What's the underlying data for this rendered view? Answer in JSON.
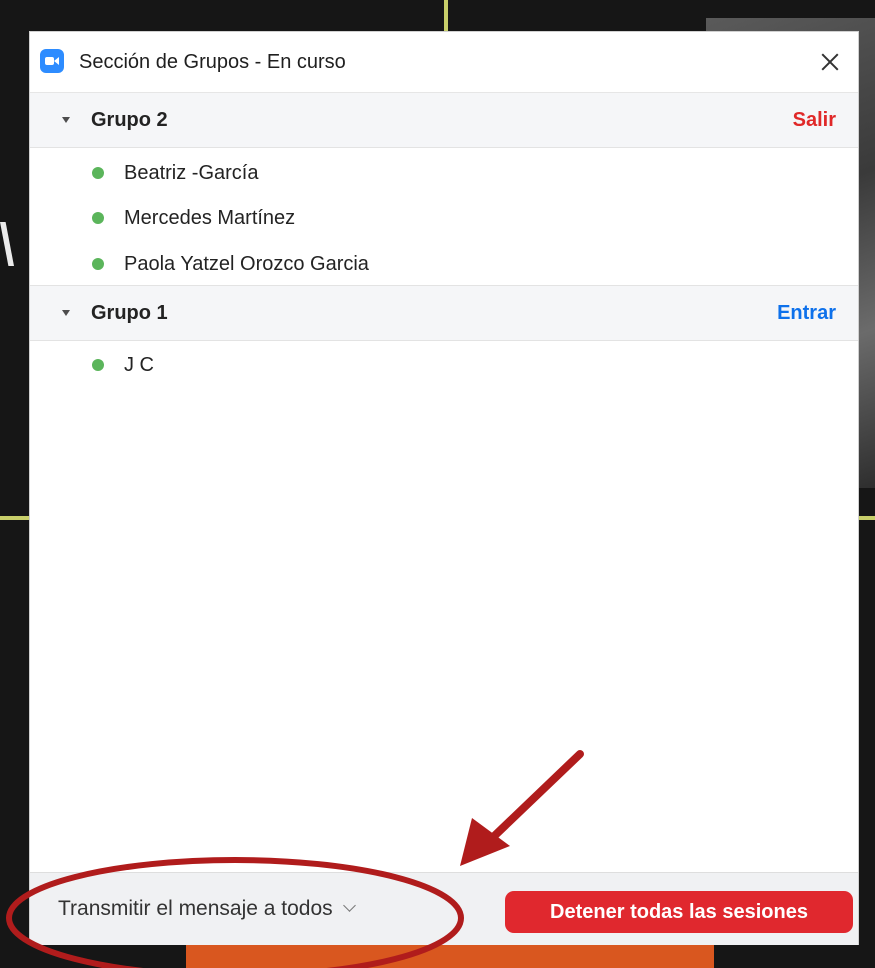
{
  "window": {
    "title": "Sección de Grupos - En curso"
  },
  "groups": [
    {
      "name": "Grupo 2",
      "action": "Salir",
      "members": [
        "Beatriz -García",
        "Mercedes Martínez",
        "Paola Yatzel Orozco Garcia"
      ]
    },
    {
      "name": "Grupo 1",
      "action": "Entrar",
      "members": [
        "J C"
      ]
    }
  ],
  "footer": {
    "broadcast_label": "Transmitir el mensaje a todos",
    "stop_label": "Detener todas las sesiones"
  },
  "icons": {
    "app": "zoom-camera-icon",
    "close": "close-icon",
    "caret": "caret-down-icon",
    "status": "online-status-dot",
    "dropdown": "chevron-down-icon"
  },
  "colors": {
    "brand": "#2d8cff",
    "exit": "#e02828",
    "join": "#0e71eb",
    "stop_button": "#e0282e",
    "online": "#5bb55b",
    "annotation": "#b01c1c"
  }
}
